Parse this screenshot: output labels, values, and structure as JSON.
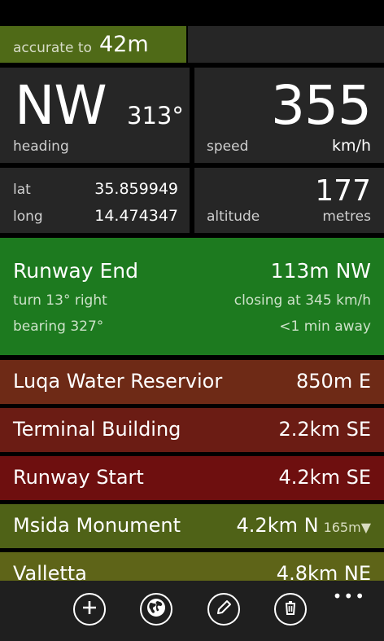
{
  "accuracy": {
    "label": "accurate to",
    "value": "42m"
  },
  "heading": {
    "direction": "NW",
    "degrees": "313°",
    "label": "heading"
  },
  "speed": {
    "value": "355",
    "label": "speed",
    "unit": "km/h"
  },
  "position": {
    "lat_label": "lat",
    "lat": "35.859949",
    "long_label": "long",
    "long": "14.474347"
  },
  "altitude": {
    "value": "177",
    "label": "altitude",
    "unit": "metres"
  },
  "active_waypoint": {
    "name": "Runway End",
    "distance": "113m NW",
    "turn": "turn 13° right",
    "closing": "closing at 345 km/h",
    "bearing": "bearing 327°",
    "eta": "<1 min away",
    "color": "#1d7a1f"
  },
  "waypoints": [
    {
      "name": "Luqa Water Reservior",
      "distance": "850m E",
      "color": "#6e2a16"
    },
    {
      "name": "Terminal Building",
      "distance": "2.2km SE",
      "color": "#6b1c14"
    },
    {
      "name": "Runway Start",
      "distance": "4.2km SE",
      "color": "#6e0f0f"
    },
    {
      "name": "Msida Monument",
      "distance": "4.2km N",
      "altitude": "165m▼",
      "color": "#4f6217"
    },
    {
      "name": "Valletta",
      "distance": "4.8km NE",
      "color": "#5e6418"
    }
  ],
  "appbar": {
    "buttons": [
      {
        "icon": "add-icon"
      },
      {
        "icon": "globe-icon"
      },
      {
        "icon": "edit-icon"
      },
      {
        "icon": "delete-icon"
      }
    ],
    "more": "•••"
  }
}
